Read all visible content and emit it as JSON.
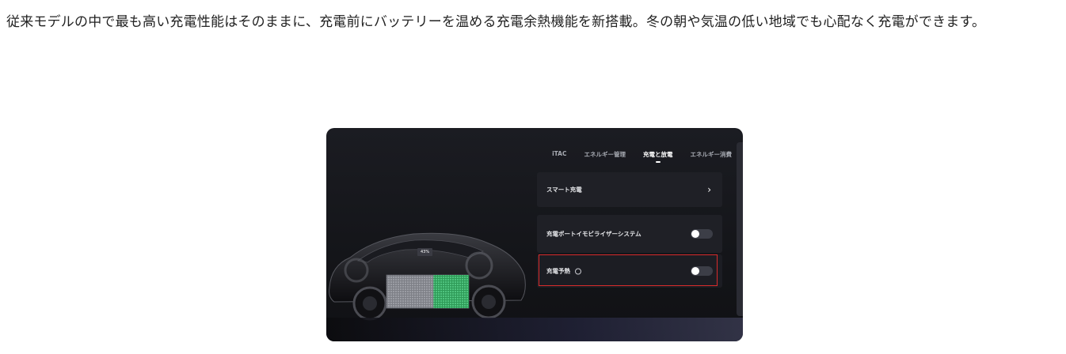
{
  "intro_text": "従来モデルの中で最も高い充電性能はそのままに、充電前にバッテリーを温める充電余熱機能を新搭載。冬の朝や気温の低い地域でも心配なく充電ができます。",
  "screen": {
    "tabs": [
      {
        "label": "iTAC",
        "active": false
      },
      {
        "label": "エネルギー管理",
        "active": false
      },
      {
        "label": "充電と放電",
        "active": true
      },
      {
        "label": "エネルギー消費",
        "active": false
      }
    ],
    "battery_percent_label": "43%",
    "battery_level": 0.43,
    "settings": {
      "smart_charge_label": "スマート充電",
      "charge_port_immobilizer_label": "充電ポートイモビライザーシステム",
      "charge_port_immobilizer_on": false,
      "charge_preheat_label": "充電予熱",
      "charge_preheat_on": false
    },
    "colors": {
      "highlight": "#d92b2b",
      "battery_fill": "#3fb36a"
    },
    "icons": [
      "chevron-right-icon",
      "info-icon"
    ]
  }
}
